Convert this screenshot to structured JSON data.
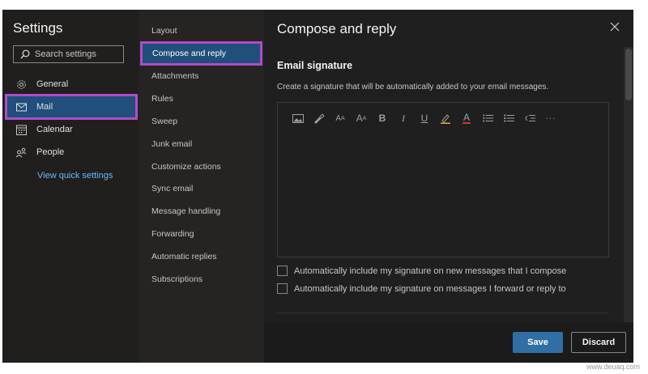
{
  "settings": {
    "title": "Settings",
    "search_placeholder": "Search settings",
    "nav": [
      {
        "label": "General",
        "icon": "gear-icon"
      },
      {
        "label": "Mail",
        "icon": "mail-icon",
        "active": true
      },
      {
        "label": "Calendar",
        "icon": "calendar-icon"
      },
      {
        "label": "People",
        "icon": "people-icon"
      }
    ],
    "quick_link": "View quick settings"
  },
  "mail_menu": {
    "items": [
      "Layout",
      "Compose and reply",
      "Attachments",
      "Rules",
      "Sweep",
      "Junk email",
      "Customize actions",
      "Sync email",
      "Message handling",
      "Forwarding",
      "Automatic replies",
      "Subscriptions"
    ],
    "active_index": 1
  },
  "pane": {
    "title": "Compose and reply",
    "section_title": "Email signature",
    "section_desc": "Create a signature that will be automatically added to your email messages.",
    "toolbar": {
      "bold": "B",
      "italic": "I",
      "underline": "U",
      "font_color": "A",
      "font_size": "A",
      "font_size_sup": "A",
      "more": "···"
    },
    "checks": [
      {
        "label": "Automatically include my signature on new messages that I compose",
        "checked": false
      },
      {
        "label": "Automatically include my signature on messages I forward or reply to",
        "checked": false
      }
    ],
    "save_label": "Save",
    "discard_label": "Discard"
  },
  "watermark": "www.deuaq.com",
  "colors": {
    "accent": "#2f6fa3",
    "highlight_border": "#b04cc8",
    "link": "#6cb8f6",
    "selected_bg": "#1f4f7a"
  }
}
